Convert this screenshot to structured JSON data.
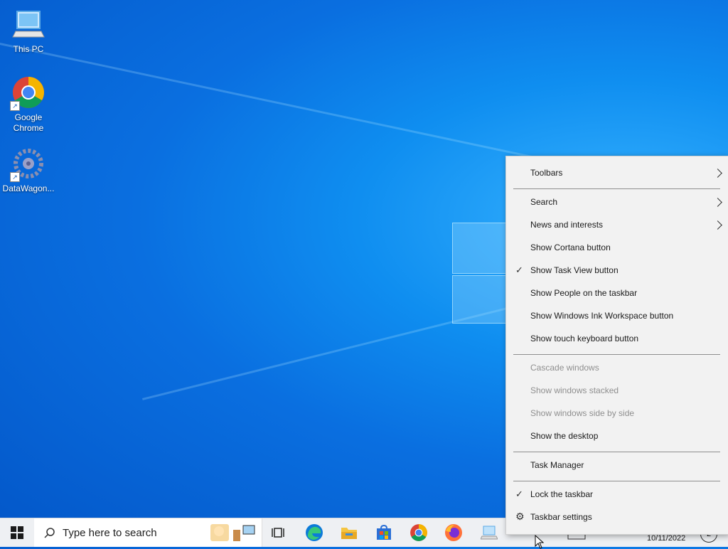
{
  "desktop": {
    "icons": [
      {
        "label": "This PC",
        "icon": "this-pc-icon"
      },
      {
        "label": "Google Chrome",
        "icon": "chrome-icon"
      },
      {
        "label": "DataWagon...",
        "icon": "datawagon-icon"
      }
    ]
  },
  "taskbar": {
    "search_placeholder": "Type here to search",
    "apps": [
      "task-view-icon",
      "edge-icon",
      "file-explorer-icon",
      "store-icon",
      "chrome-icon",
      "firefox-icon",
      "network-pc-icon"
    ],
    "date": "10/11/2022",
    "notification_count": "2"
  },
  "context_menu": {
    "toolbars": "Toolbars",
    "search": "Search",
    "news": "News and interests",
    "cortana": "Show Cortana button",
    "task_view": "Show Task View button",
    "people": "Show People on the taskbar",
    "ink": "Show Windows Ink Workspace button",
    "touch_keyboard": "Show touch keyboard button",
    "cascade": "Cascade windows",
    "stacked": "Show windows stacked",
    "side_by_side": "Show windows side by side",
    "show_desktop": "Show the desktop",
    "task_manager": "Task Manager",
    "lock": "Lock the taskbar",
    "settings": "Taskbar settings",
    "check_mark": "✓",
    "gear": "⚙"
  }
}
